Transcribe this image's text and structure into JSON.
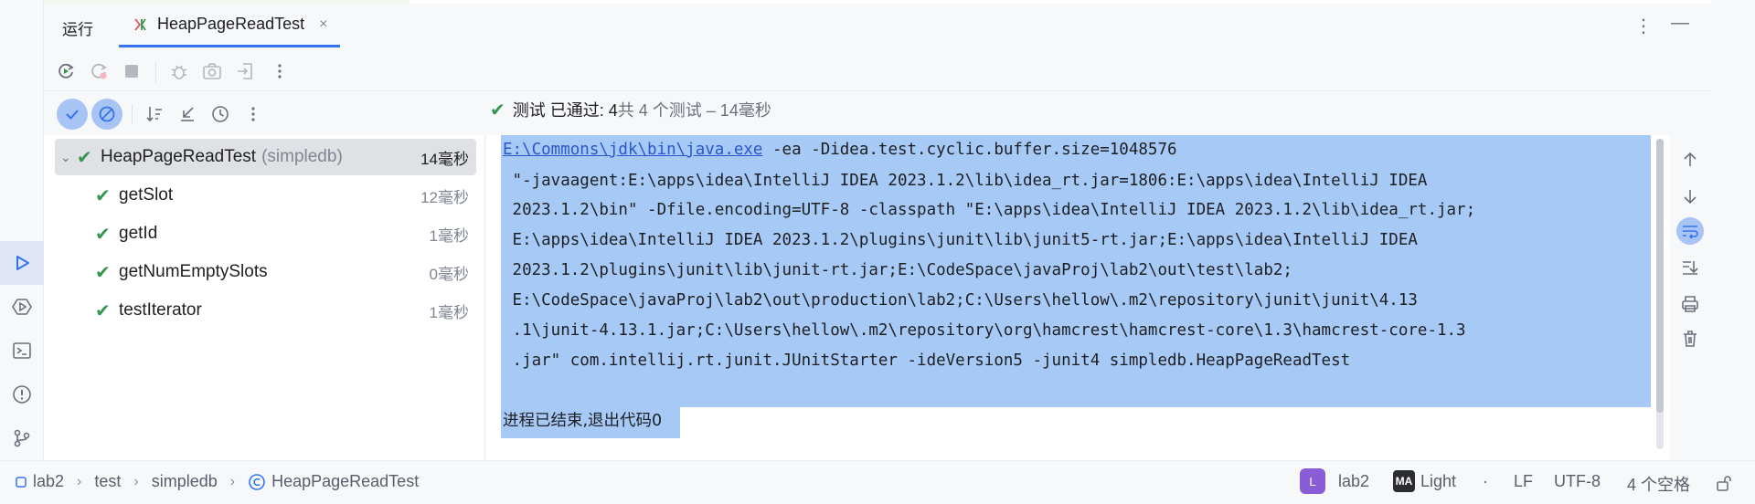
{
  "tool_window": {
    "title": "运行",
    "tab_label": "HeapPageReadTest",
    "tab_close": "×",
    "more_icon": "⋮",
    "minimize_icon": "—"
  },
  "summary": {
    "status_icon": "✔",
    "passed_text": "测试 已通过: 4",
    "count_text": "共 4 个测试 – 14毫秒"
  },
  "tree": {
    "root": {
      "name": "HeapPageReadTest",
      "package": "(simpledb)",
      "duration": "14毫秒"
    },
    "children": [
      {
        "name": "getSlot",
        "duration": "12毫秒"
      },
      {
        "name": "getId",
        "duration": "1毫秒"
      },
      {
        "name": "getNumEmptySlots",
        "duration": "0毫秒"
      },
      {
        "name": "testIterator",
        "duration": "1毫秒"
      }
    ],
    "check_glyph": "✔",
    "chevron_glyph": "⌄"
  },
  "console": {
    "java_link": "E:\\Commons\\jdk\\bin\\java.exe",
    "line1_rest": " -ea -Didea.test.cyclic.buffer.size=1048576",
    "lines": [
      " \"-javaagent:E:\\apps\\idea\\IntelliJ IDEA 2023.1.2\\lib\\idea_rt.jar=1806:E:\\apps\\idea\\IntelliJ IDEA",
      " 2023.1.2\\bin\" -Dfile.encoding=UTF-8 -classpath \"E:\\apps\\idea\\IntelliJ IDEA 2023.1.2\\lib\\idea_rt.jar;",
      " E:\\apps\\idea\\IntelliJ IDEA 2023.1.2\\plugins\\junit\\lib\\junit5-rt.jar;E:\\apps\\idea\\IntelliJ IDEA",
      " 2023.1.2\\plugins\\junit\\lib\\junit-rt.jar;E:\\CodeSpace\\javaProj\\lab2\\out\\test\\lab2;",
      " E:\\CodeSpace\\javaProj\\lab2\\out\\production\\lab2;C:\\Users\\hellow\\.m2\\repository\\junit\\junit\\4.13",
      " .1\\junit-4.13.1.jar;C:\\Users\\hellow\\.m2\\repository\\org\\hamcrest\\hamcrest-core\\1.3\\hamcrest-core-1.3",
      " .jar\" com.intellij.rt.junit.JUnitStarter -ideVersion5 -junit4 simpledb.HeapPageReadTest"
    ],
    "exit_line": "进程已结束,退出代码0"
  },
  "status_bar": {
    "crumbs": [
      "lab2",
      "test",
      "simpledb",
      "HeapPageReadTest"
    ],
    "module_badge": "L",
    "module": "lab2",
    "theme_badge": "MA",
    "theme": "Light",
    "dot": "·",
    "line_sep": "LF",
    "encoding": "UTF-8",
    "indent": "4 个空格"
  },
  "colors": {
    "accent": "#3574f0",
    "success": "#369650",
    "selection": "#a7c9f6"
  }
}
